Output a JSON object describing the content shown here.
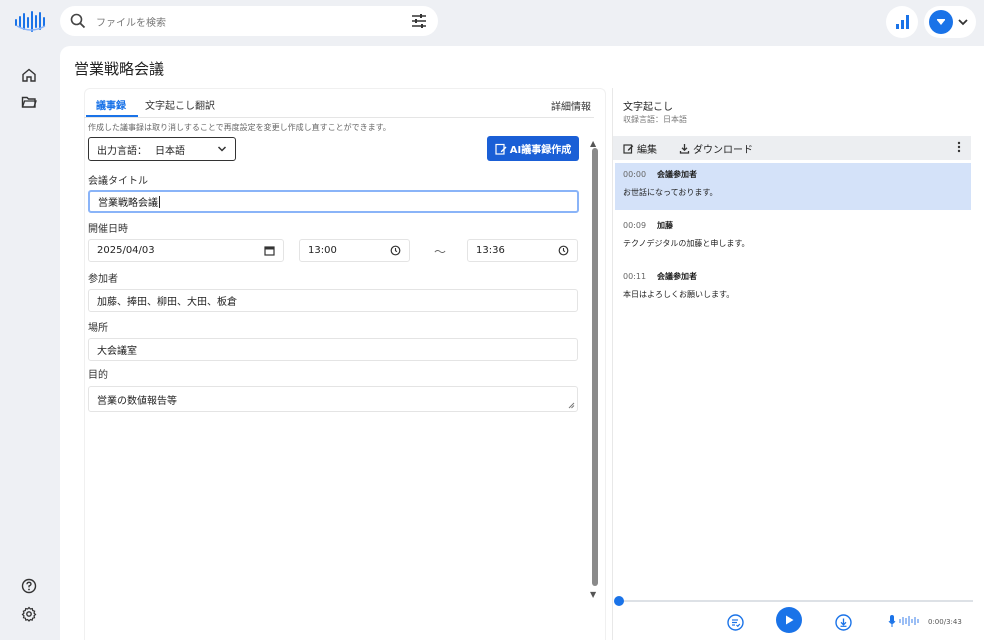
{
  "header": {
    "search_placeholder": "ファイルを検索"
  },
  "colors": {
    "primary": "#1a73e8",
    "button": "#1a5fd6",
    "highlight": "#d4e2f9"
  },
  "icons": {
    "search": "search-icon",
    "filter": "filter-icon",
    "stats": "bar-chart-icon",
    "avatar": "user-avatar-icon",
    "home": "home-icon",
    "folder": "folder-icon",
    "help": "help-icon",
    "settings": "gear-icon"
  },
  "page": {
    "title": "営業戦略会議"
  },
  "tabs": [
    {
      "label": "議事録",
      "active": true
    },
    {
      "label": "文字起こし翻訳",
      "active": false
    }
  ],
  "detail_link": "詳細情報",
  "hint": "作成した議事録は取り消しすることで再度設定を変更し作成し直すことができます。",
  "lang_select": {
    "label": "出力言語：",
    "value": "日本語"
  },
  "ai_button": "AI議事録作成",
  "form": {
    "title_label": "会議タイトル",
    "title_value": "営業戦略会議",
    "date_label": "開催日時",
    "date_value": "2025/04/03",
    "start_time": "13:00",
    "tilde": "〜",
    "end_time": "13:36",
    "participants_label": "参加者",
    "participants_value": "加藤、捧田、柳田、大田、板倉",
    "place_label": "場所",
    "place_value": "大会議室",
    "purpose_label": "目的",
    "purpose_value": "営業の数値報告等"
  },
  "transcript": {
    "title": "文字起こし",
    "sub": "収録言語：日本語",
    "edit_label": "編集",
    "download_label": "ダウンロード",
    "segments": [
      {
        "time": "00:00",
        "speaker": "会議参加者",
        "text": "お世話になっております。",
        "active": true
      },
      {
        "time": "00:09",
        "speaker": "加藤",
        "text": "テクノデジタルの加藤と申します。",
        "active": false
      },
      {
        "time": "00:11",
        "speaker": "会議参加者",
        "text": "本日はよろしくお願いします。",
        "active": false
      }
    ]
  },
  "player": {
    "timecode": "0:00/3:43",
    "progress": 0
  }
}
